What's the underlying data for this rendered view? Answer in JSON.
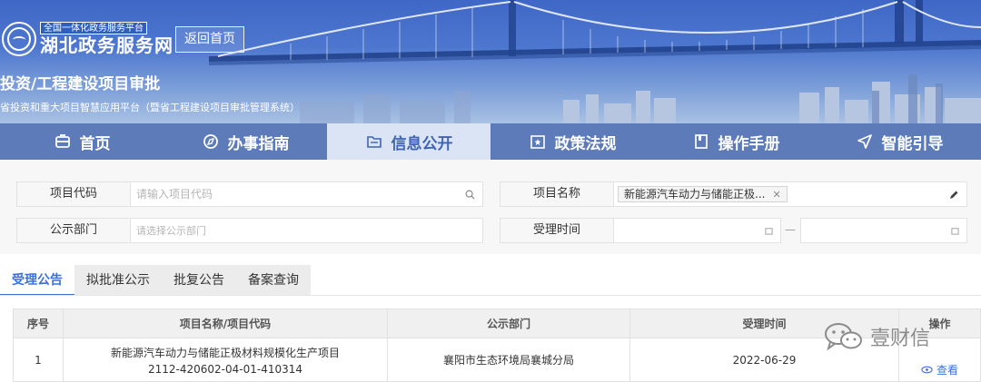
{
  "header": {
    "platform_tag": "全国一体化政务服务平台",
    "site_name": "湖北政务服务网",
    "back_home": "返回首页",
    "system_title": "投资/工程建设项目审批",
    "system_subtitle": "省投资和重大项目智慧应用平台（暨省工程建设项目审批管理系统）"
  },
  "nav": {
    "items": [
      {
        "label": "首页",
        "icon": "home-icon"
      },
      {
        "label": "办事指南",
        "icon": "compass-icon"
      },
      {
        "label": "信息公开",
        "icon": "folder-icon"
      },
      {
        "label": "政策法规",
        "icon": "policy-icon"
      },
      {
        "label": "操作手册",
        "icon": "book-icon"
      },
      {
        "label": "智能引导",
        "icon": "navigation-icon"
      }
    ],
    "active_index": 2
  },
  "search": {
    "project_code_label": "项目代码",
    "project_code_placeholder": "请输入项目代码",
    "project_name_label": "项目名称",
    "project_name_tag": "新能源汽车动力与储能正极...",
    "dept_label": "公示部门",
    "dept_placeholder": "请选择公示部门",
    "time_label": "受理时间",
    "range_separator": "—"
  },
  "tabs": [
    "受理公告",
    "拟批准公示",
    "批复公告",
    "备案查询"
  ],
  "table": {
    "headers": [
      "序号",
      "项目名称/项目代码",
      "公示部门",
      "受理时间",
      "操作"
    ],
    "rows": [
      {
        "index": "1",
        "project_name": "新能源汽车动力与储能正极材料规模化生产项目",
        "project_code": "2112-420602-04-01-410314",
        "dept": "襄阳市生态环境局襄城分局",
        "date": "2022-06-29",
        "action": "查看"
      }
    ]
  },
  "watermark": "壹财信",
  "colors": {
    "nav_bg": "#5d7bb8",
    "nav_active_bg": "#dbe4f4",
    "accent": "#3e72d8",
    "banner_top": "#3f67c6"
  }
}
